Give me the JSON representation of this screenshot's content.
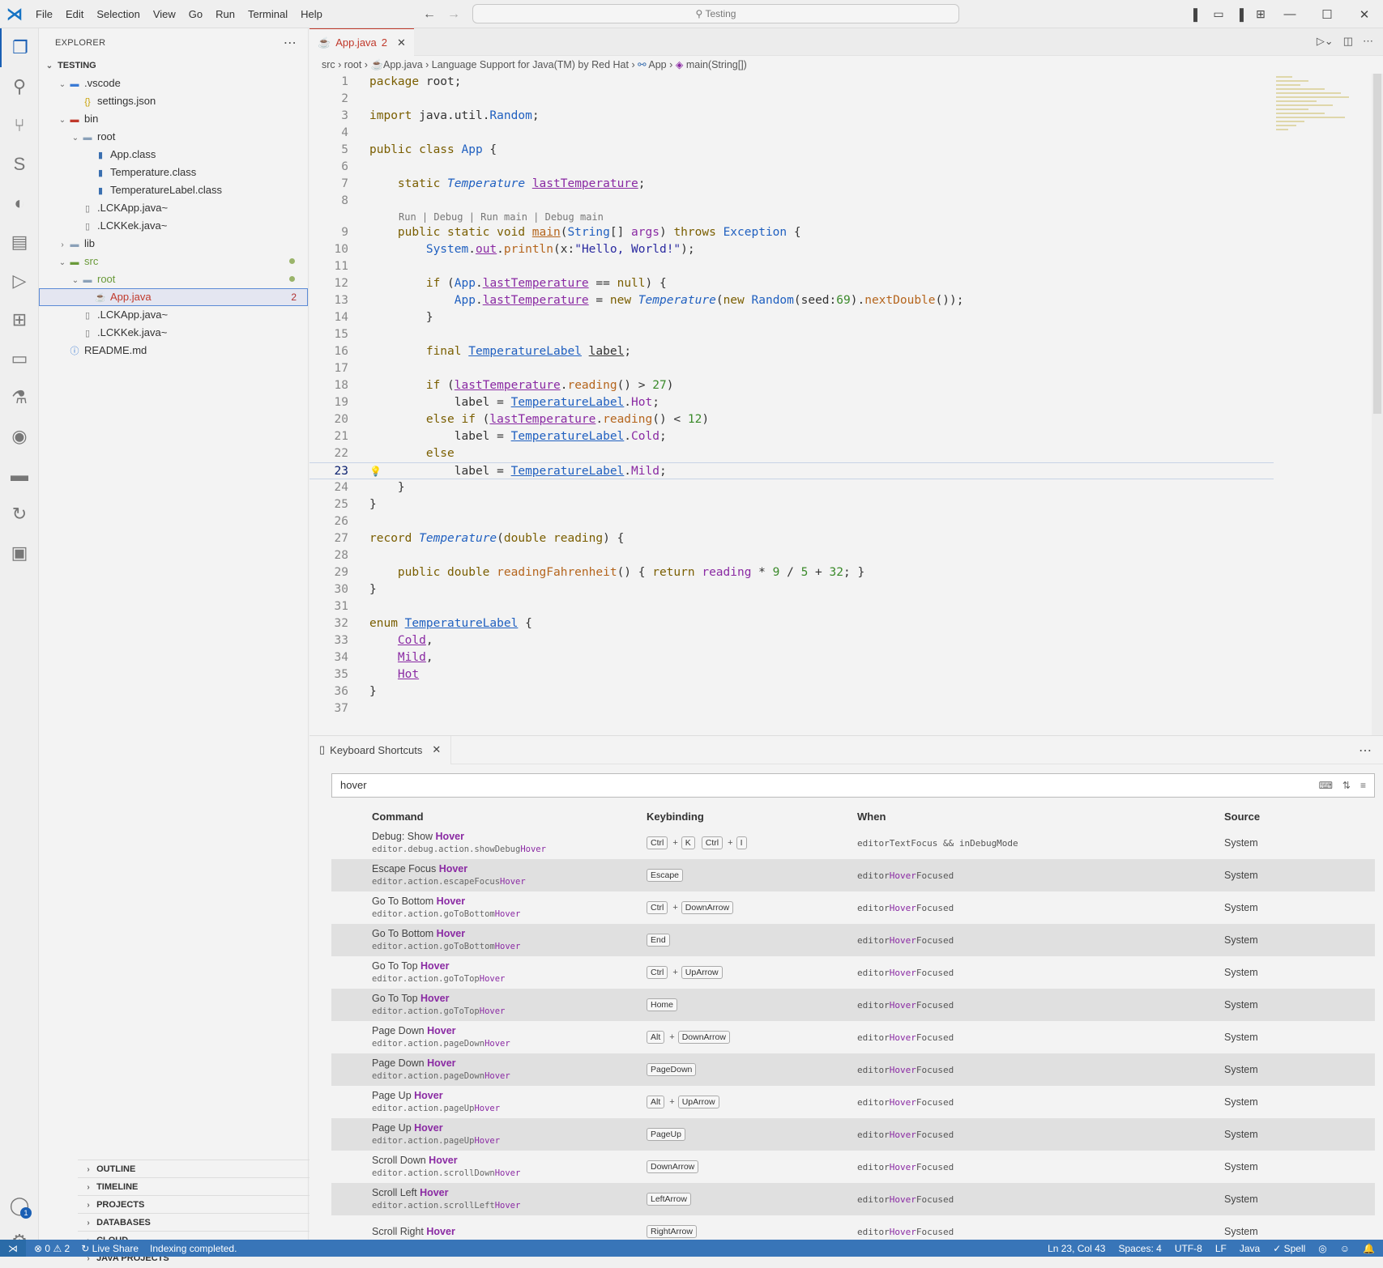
{
  "titlebar": {
    "menu": [
      "File",
      "Edit",
      "Selection",
      "View",
      "Go",
      "Run",
      "Terminal",
      "Help"
    ],
    "search": "Testing"
  },
  "activity": {
    "account_badge": "1",
    "settings_badge": "1"
  },
  "explorer": {
    "title": "EXPLORER",
    "root": "TESTING",
    "items": [
      {
        "label": ".vscode",
        "depth": 1,
        "twisty": "open",
        "icon": "folder-icon"
      },
      {
        "label": "settings.json",
        "depth": 2,
        "icon": "json-icon"
      },
      {
        "label": "bin",
        "depth": 1,
        "twisty": "open",
        "icon": "folder-icon"
      },
      {
        "label": "root",
        "depth": 2,
        "twisty": "open",
        "icon": "folder-icon"
      },
      {
        "label": "App.class",
        "depth": 3,
        "icon": "class-icon"
      },
      {
        "label": "Temperature.class",
        "depth": 3,
        "icon": "class-icon"
      },
      {
        "label": "TemperatureLabel.class",
        "depth": 3,
        "icon": "class-icon"
      },
      {
        "label": ".LCKApp.java~",
        "depth": 2,
        "icon": "file-icon"
      },
      {
        "label": ".LCKKek.java~",
        "depth": 2,
        "icon": "file-icon"
      },
      {
        "label": "lib",
        "depth": 1,
        "twisty": "closed",
        "icon": "folder-icon"
      },
      {
        "label": "src",
        "depth": 1,
        "twisty": "open",
        "icon": "folder-icon"
      },
      {
        "label": "root",
        "depth": 2,
        "twisty": "open",
        "icon": "folder-icon"
      },
      {
        "label": "App.java",
        "depth": 3,
        "icon": "java-icon",
        "count": "2"
      },
      {
        "label": ".LCKApp.java~",
        "depth": 2,
        "icon": "file-icon"
      },
      {
        "label": ".LCKKek.java~",
        "depth": 2,
        "icon": "file-icon"
      },
      {
        "label": "README.md",
        "depth": 1,
        "icon": "info-icon"
      }
    ],
    "panels": [
      "OUTLINE",
      "TIMELINE",
      "PROJECTS",
      "DATABASES",
      "CLOUD",
      "JAVA PROJECTS"
    ]
  },
  "editor": {
    "tab_label": "App.java",
    "tab_count": "2",
    "breadcrumbs": [
      "src",
      "root",
      "App.java",
      "Language Support for Java(TM) by Red Hat",
      "App",
      "main(String[])"
    ],
    "codelens": "Run | Debug | Run main | Debug main",
    "line_numbers": [
      "1",
      "2",
      "3",
      "4",
      "5",
      "6",
      "7",
      "8",
      "9",
      "10",
      "11",
      "12",
      "13",
      "14",
      "15",
      "16",
      "17",
      "18",
      "19",
      "20",
      "21",
      "22",
      "23",
      "24",
      "25",
      "26",
      "27",
      "28",
      "29",
      "30",
      "31",
      "32",
      "33",
      "34",
      "35",
      "36",
      "37"
    ]
  },
  "shortcuts": {
    "tab_label": "Keyboard Shortcuts",
    "search_value": "hover",
    "headers": {
      "command": "Command",
      "keybinding": "Keybinding",
      "when": "When",
      "source": "Source"
    },
    "rows": [
      {
        "pre": "Debug: Show ",
        "hl": "Hover",
        "id_pre": "editor.debug.action.showDebug",
        "id_hl": "Hover",
        "keys": [
          [
            "Ctrl",
            "K"
          ],
          [
            "Ctrl",
            "I"
          ]
        ],
        "when_pre": "editorTextFocus && inDebugMode",
        "when_hl": "",
        "when_post": "",
        "source": "System"
      },
      {
        "pre": "Escape Focus ",
        "hl": "Hover",
        "id_pre": "editor.action.escapeFocus",
        "id_hl": "Hover",
        "keys": [
          [
            "Escape"
          ]
        ],
        "when_pre": "editor",
        "when_hl": "Hover",
        "when_post": "Focused",
        "source": "System"
      },
      {
        "pre": "Go To Bottom ",
        "hl": "Hover",
        "id_pre": "editor.action.goToBottom",
        "id_hl": "Hover",
        "keys": [
          [
            "Ctrl",
            "DownArrow"
          ]
        ],
        "when_pre": "editor",
        "when_hl": "Hover",
        "when_post": "Focused",
        "source": "System"
      },
      {
        "pre": "Go To Bottom ",
        "hl": "Hover",
        "id_pre": "editor.action.goToBottom",
        "id_hl": "Hover",
        "keys": [
          [
            "End"
          ]
        ],
        "when_pre": "editor",
        "when_hl": "Hover",
        "when_post": "Focused",
        "source": "System"
      },
      {
        "pre": "Go To Top ",
        "hl": "Hover",
        "id_pre": "editor.action.goToTop",
        "id_hl": "Hover",
        "keys": [
          [
            "Ctrl",
            "UpArrow"
          ]
        ],
        "when_pre": "editor",
        "when_hl": "Hover",
        "when_post": "Focused",
        "source": "System"
      },
      {
        "pre": "Go To Top ",
        "hl": "Hover",
        "id_pre": "editor.action.goToTop",
        "id_hl": "Hover",
        "keys": [
          [
            "Home"
          ]
        ],
        "when_pre": "editor",
        "when_hl": "Hover",
        "when_post": "Focused",
        "source": "System"
      },
      {
        "pre": "Page Down ",
        "hl": "Hover",
        "id_pre": "editor.action.pageDown",
        "id_hl": "Hover",
        "keys": [
          [
            "Alt",
            "DownArrow"
          ]
        ],
        "when_pre": "editor",
        "when_hl": "Hover",
        "when_post": "Focused",
        "source": "System"
      },
      {
        "pre": "Page Down ",
        "hl": "Hover",
        "id_pre": "editor.action.pageDown",
        "id_hl": "Hover",
        "keys": [
          [
            "PageDown"
          ]
        ],
        "when_pre": "editor",
        "when_hl": "Hover",
        "when_post": "Focused",
        "source": "System"
      },
      {
        "pre": "Page Up ",
        "hl": "Hover",
        "id_pre": "editor.action.pageUp",
        "id_hl": "Hover",
        "keys": [
          [
            "Alt",
            "UpArrow"
          ]
        ],
        "when_pre": "editor",
        "when_hl": "Hover",
        "when_post": "Focused",
        "source": "System"
      },
      {
        "pre": "Page Up ",
        "hl": "Hover",
        "id_pre": "editor.action.pageUp",
        "id_hl": "Hover",
        "keys": [
          [
            "PageUp"
          ]
        ],
        "when_pre": "editor",
        "when_hl": "Hover",
        "when_post": "Focused",
        "source": "System"
      },
      {
        "pre": "Scroll Down ",
        "hl": "Hover",
        "id_pre": "editor.action.scrollDown",
        "id_hl": "Hover",
        "keys": [
          [
            "DownArrow"
          ]
        ],
        "when_pre": "editor",
        "when_hl": "Hover",
        "when_post": "Focused",
        "source": "System"
      },
      {
        "pre": "Scroll Left ",
        "hl": "Hover",
        "id_pre": "editor.action.scrollLeft",
        "id_hl": "Hover",
        "keys": [
          [
            "LeftArrow"
          ]
        ],
        "when_pre": "editor",
        "when_hl": "Hover",
        "when_post": "Focused",
        "source": "System"
      },
      {
        "pre": "Scroll Right ",
        "hl": "Hover",
        "id_pre": "",
        "id_hl": "",
        "keys": [
          [
            "RightArrow"
          ]
        ],
        "when_pre": "editor",
        "when_hl": "Hover",
        "when_post": "Focused",
        "source": "System"
      }
    ]
  },
  "statusbar": {
    "errors": "0",
    "warnings": "2",
    "live_share": "Live Share",
    "message": "Indexing completed.",
    "position": "Ln 23, Col 43",
    "spaces": "Spaces: 4",
    "encoding": "UTF-8",
    "eol": "LF",
    "language": "Java",
    "spell": "Spell"
  }
}
